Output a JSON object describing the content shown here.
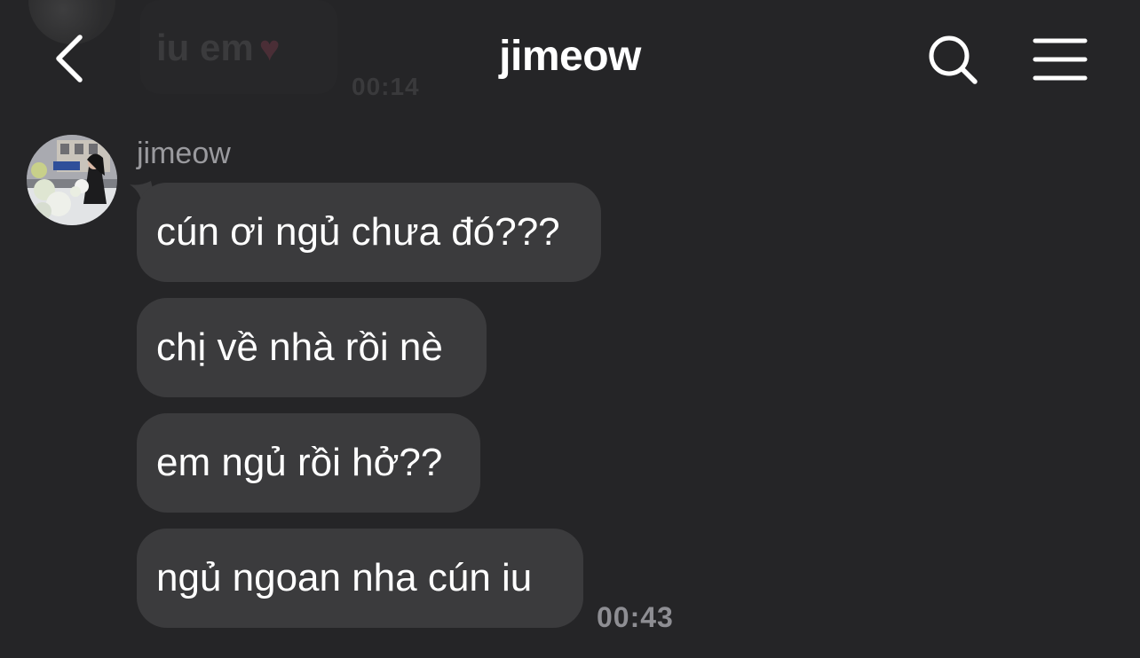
{
  "previous_message": {
    "text": "iu em",
    "emoji": "♥",
    "time": "00:14"
  },
  "header": {
    "title": "jimeow",
    "back_icon": "chevron-left-icon",
    "search_icon": "search-icon",
    "menu_icon": "hamburger-menu-icon"
  },
  "conversation": {
    "sender_name": "jimeow",
    "messages": [
      {
        "text": "cún ơi ngủ chưa đó???"
      },
      {
        "text": "chị về nhà rồi nè"
      },
      {
        "text": "em ngủ rồi hở??"
      },
      {
        "text": "ngủ ngoan nha cún iu"
      }
    ],
    "last_time": "00:43"
  },
  "colors": {
    "background": "#252527",
    "bubble": "#3b3b3d",
    "text": "#ffffff",
    "meta_text": "#8e8e93"
  }
}
